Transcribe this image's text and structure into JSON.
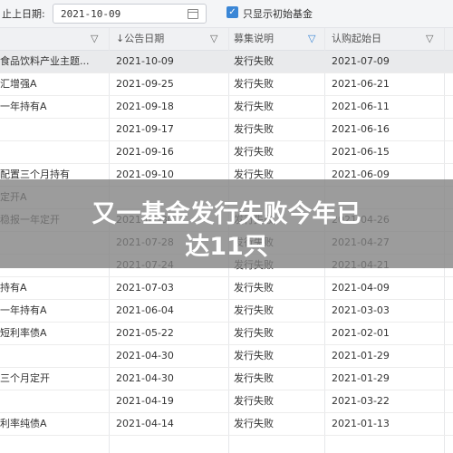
{
  "toolbar": {
    "date_label": "止上日期:",
    "date_value": "2021-10-09",
    "checkbox_label": "只显示初始基金",
    "checkbox_checked": true
  },
  "table": {
    "columns": [
      {
        "label": ""
      },
      {
        "label": "↓公告日期"
      },
      {
        "label": "募集说明"
      },
      {
        "label": "认购起始日"
      }
    ],
    "rows": [
      {
        "fund": "食品饮料产业主题...",
        "announce_date": "2021-10-09",
        "status": "发行失败",
        "start_date": "2021-07-09"
      },
      {
        "fund": "汇增强A",
        "announce_date": "2021-09-25",
        "status": "发行失败",
        "start_date": "2021-06-21"
      },
      {
        "fund": "一年持有A",
        "announce_date": "2021-09-18",
        "status": "发行失败",
        "start_date": "2021-06-11"
      },
      {
        "fund": "",
        "announce_date": "2021-09-17",
        "status": "发行失败",
        "start_date": "2021-06-16"
      },
      {
        "fund": "",
        "announce_date": "2021-09-16",
        "status": "发行失败",
        "start_date": "2021-06-15"
      },
      {
        "fund": "配置三个月持有",
        "announce_date": "2021-09-10",
        "status": "发行失败",
        "start_date": "2021-06-09"
      },
      {
        "fund": "定开A",
        "announce_date": "",
        "status": "",
        "start_date": ""
      },
      {
        "fund": "稳报一年定开",
        "announce_date": "2021-07-30",
        "status": "发行失败",
        "start_date": "2021-04-26"
      },
      {
        "fund": "",
        "announce_date": "2021-07-28",
        "status": "发行失败",
        "start_date": "2021-04-27"
      },
      {
        "fund": "",
        "announce_date": "2021-07-24",
        "status": "发行失败",
        "start_date": "2021-04-21"
      },
      {
        "fund": "持有A",
        "announce_date": "2021-07-03",
        "status": "发行失败",
        "start_date": "2021-04-09"
      },
      {
        "fund": "一年持有A",
        "announce_date": "2021-06-04",
        "status": "发行失败",
        "start_date": "2021-03-03"
      },
      {
        "fund": "短利率债A",
        "announce_date": "2021-05-22",
        "status": "发行失败",
        "start_date": "2021-02-01"
      },
      {
        "fund": "",
        "announce_date": "2021-04-30",
        "status": "发行失败",
        "start_date": "2021-01-29"
      },
      {
        "fund": "三个月定开",
        "announce_date": "2021-04-30",
        "status": "发行失败",
        "start_date": "2021-01-29"
      },
      {
        "fund": "",
        "announce_date": "2021-04-19",
        "status": "发行失败",
        "start_date": "2021-03-22"
      },
      {
        "fund": "利率纯债A",
        "announce_date": "2021-04-14",
        "status": "发行失败",
        "start_date": "2021-01-13"
      }
    ]
  },
  "overlay": {
    "line1": "又一基金发行失败今年已",
    "line2": "达11只"
  },
  "colors": {
    "accent": "#3a86d6",
    "overlay": "#808080"
  }
}
